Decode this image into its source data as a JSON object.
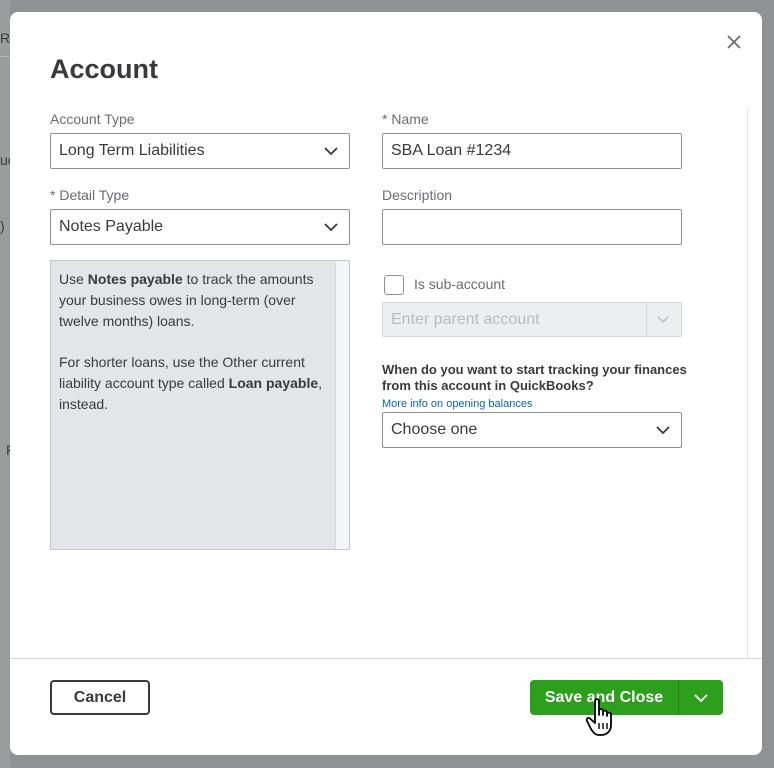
{
  "background": {
    "fragments": [
      "Re",
      "uc",
      ")",
      "F"
    ]
  },
  "modal": {
    "title": "Account",
    "close_icon": "close-icon"
  },
  "form": {
    "account_type": {
      "label": "Account Type",
      "value": "Long Term Liabilities"
    },
    "name": {
      "label": "* Name",
      "value": "SBA Loan #1234"
    },
    "detail_type": {
      "label": "* Detail Type",
      "value": "Notes Payable"
    },
    "description": {
      "label": "Description",
      "value": ""
    },
    "help": {
      "p1_pre": "Use ",
      "p1_bold": "Notes payable",
      "p1_post": " to track the amounts your business owes in long-term (over twelve months) loans.",
      "p2_pre": "For shorter loans, use the Other current liability account type called ",
      "p2_bold": "Loan payable",
      "p2_post": ", instead."
    },
    "sub_account": {
      "label": "Is sub-account",
      "checked": false
    },
    "parent_account": {
      "placeholder": "Enter parent account"
    },
    "tracking": {
      "question": "When do you want to start tracking your finances from this account in QuickBooks?",
      "link": "More info on opening balances",
      "value": "Choose one"
    }
  },
  "footer": {
    "cancel_label": "Cancel",
    "save_label": "Save and Close"
  },
  "colors": {
    "primary_green": "#2ca01c",
    "link_blue": "#0d63b6",
    "text_dark": "#393a3d"
  }
}
